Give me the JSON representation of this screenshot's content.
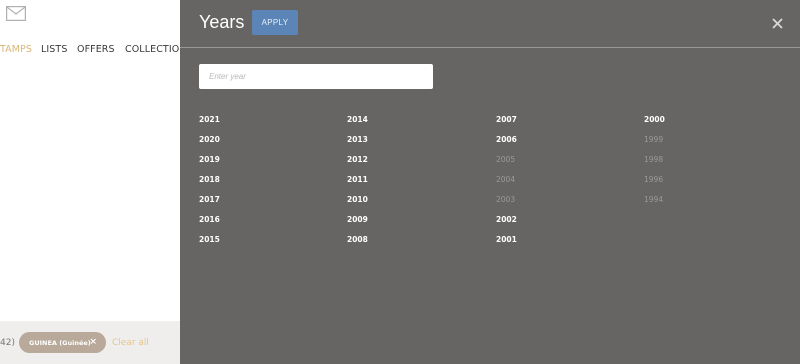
{
  "background": {
    "nav": {
      "stamps": "TAMPS",
      "lists": "LISTS",
      "offers": "OFFERS",
      "collections": "COLLECTIONS"
    },
    "filter": {
      "count": "42)",
      "chip_label": "GUINEA (Guinée)",
      "chip_close": "×",
      "clear_all": "Clear all"
    }
  },
  "panel": {
    "title": "Years",
    "apply_label": "APPLY",
    "close_glyph": "×",
    "search_placeholder": "Enter year",
    "columns": [
      [
        {
          "year": "2021",
          "enabled": true
        },
        {
          "year": "2020",
          "enabled": true
        },
        {
          "year": "2019",
          "enabled": true
        },
        {
          "year": "2018",
          "enabled": true
        },
        {
          "year": "2017",
          "enabled": true
        },
        {
          "year": "2016",
          "enabled": true
        },
        {
          "year": "2015",
          "enabled": true
        }
      ],
      [
        {
          "year": "2014",
          "enabled": true
        },
        {
          "year": "2013",
          "enabled": true
        },
        {
          "year": "2012",
          "enabled": true
        },
        {
          "year": "2011",
          "enabled": true
        },
        {
          "year": "2010",
          "enabled": true
        },
        {
          "year": "2009",
          "enabled": true
        },
        {
          "year": "2008",
          "enabled": true
        }
      ],
      [
        {
          "year": "2007",
          "enabled": true
        },
        {
          "year": "2006",
          "enabled": true
        },
        {
          "year": "2005",
          "enabled": false
        },
        {
          "year": "2004",
          "enabled": false
        },
        {
          "year": "2003",
          "enabled": false
        },
        {
          "year": "2002",
          "enabled": true
        },
        {
          "year": "2001",
          "enabled": true
        }
      ],
      [
        {
          "year": "2000",
          "enabled": true
        },
        {
          "year": "1999",
          "enabled": false
        },
        {
          "year": "1998",
          "enabled": false
        },
        {
          "year": "1996",
          "enabled": false
        },
        {
          "year": "1994",
          "enabled": false
        }
      ]
    ]
  },
  "colors": {
    "panel_bg": "#666563",
    "apply_bg": "#5b85b6",
    "accent_gold": "#d9b77a",
    "chip_bg": "#b8a99a"
  }
}
